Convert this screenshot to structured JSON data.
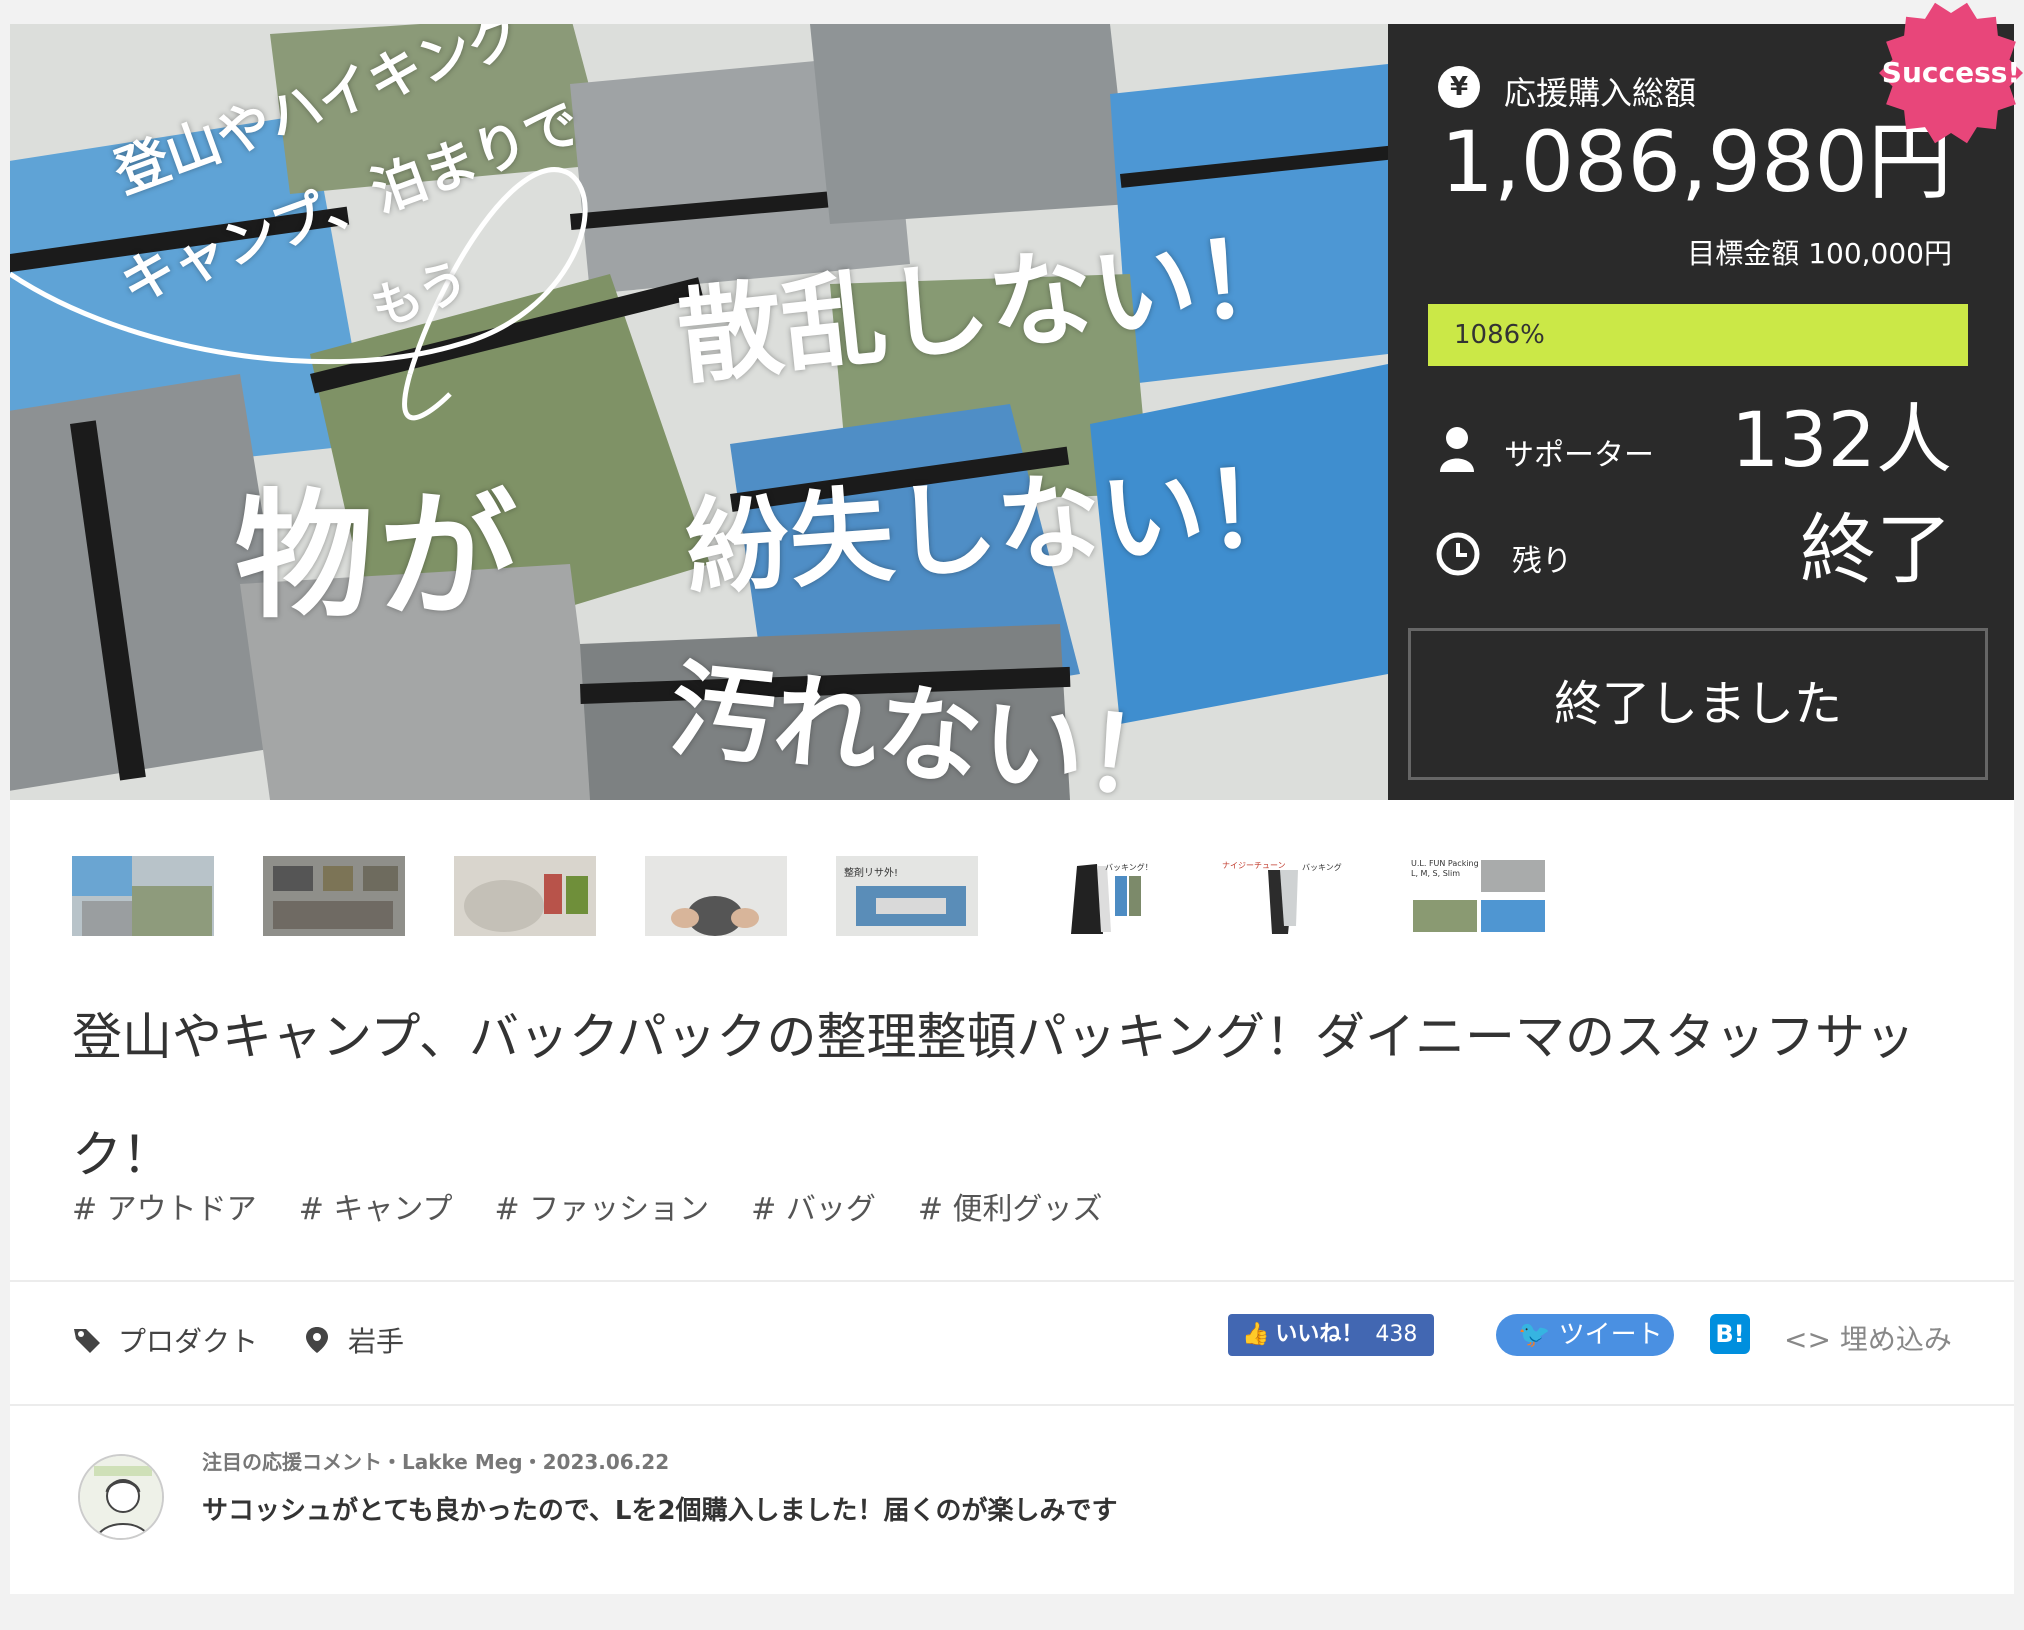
{
  "hero": {
    "line1": "登山やハイキング",
    "line2": "キャンプ、泊まりで",
    "line3": "もう",
    "line4": "物が",
    "line5": "散乱しない！",
    "line6": "紛失しない！",
    "line7": "汚れない！"
  },
  "stats": {
    "yen_icon": "¥",
    "total_label": "応援購入総額",
    "total": "1,086,980円",
    "goal": "目標金額 100,000円",
    "progress_text": "1086%",
    "progress_fraction": 1.0,
    "supporters_label": "サポーター",
    "supporters": "132人",
    "remaining_label": "残り",
    "remaining": "終了",
    "ended_button": "終了しました",
    "badge": "Success!",
    "colors": {
      "panel": "#2a2a2a",
      "progress": "#cbe847",
      "badge": "#e8467a"
    }
  },
  "thumbnails": [
    {
      "name": "thumb-1",
      "alt": "hero"
    },
    {
      "name": "thumb-2",
      "alt": "items"
    },
    {
      "name": "thumb-3",
      "alt": "packing"
    },
    {
      "name": "thumb-4",
      "alt": "hands"
    },
    {
      "name": "thumb-5",
      "alt": "pouch"
    },
    {
      "name": "thumb-6",
      "alt": "backpack"
    },
    {
      "name": "thumb-7",
      "alt": "backpack2"
    },
    {
      "name": "thumb-8",
      "alt": "sizes"
    }
  ],
  "thumbnail_captions": {
    "t5": "整剤リサ外!",
    "t6": "バッキング！",
    "t7": "ナイジーチューン",
    "t7b": "バッキング",
    "t8a": "U.L. FUN Packing",
    "t8b": "L, M, S, Slim"
  },
  "title": "登山やキャンプ、バックパックの整理整頓パッキング！ダイニーマのスタッフサック！",
  "tags": [
    "# アウトドア",
    "# キャンプ",
    "# ファッション",
    "# バッグ",
    "# 便利グッズ"
  ],
  "meta": {
    "category": "プロダクト",
    "location": "岩手"
  },
  "social": {
    "like_label": "いいね！",
    "like_count": "438",
    "tweet_label": "ツイート",
    "hatena_label": "B!",
    "embed_label": "埋め込み"
  },
  "comment": {
    "meta": "注目の応援コメント・Lakke Meg・2023.06.22",
    "text": "サコッシュがとても良かったので、Lを2個購入しました！届くのが楽しみです"
  }
}
